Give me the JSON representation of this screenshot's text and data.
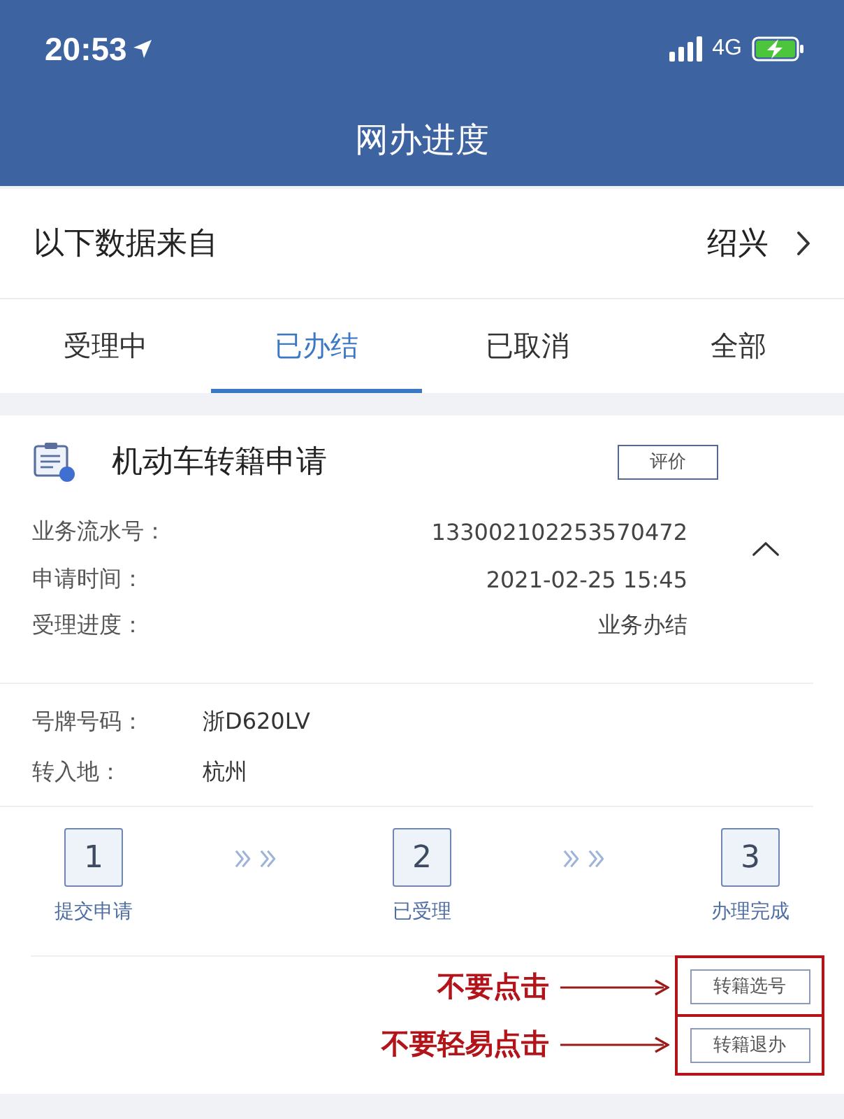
{
  "status_bar": {
    "time": "20:53",
    "network": "4G",
    "charging": true
  },
  "nav_bar": {
    "title": "网办进度"
  },
  "source": {
    "label": "以下数据来自",
    "city": "绍兴"
  },
  "tabs": [
    {
      "label": "受理中",
      "selected": false
    },
    {
      "label": "已办结",
      "selected": true
    },
    {
      "label": "已取消",
      "selected": false
    },
    {
      "label": "全部",
      "selected": false
    }
  ],
  "application": {
    "title": "机动车转籍申请",
    "rate_button": "评价",
    "expanded": true,
    "details": [
      {
        "label": "业务流水号：",
        "value": "133002102253570472"
      },
      {
        "label": "申请时间：",
        "value": "2021-02-25 15:45"
      },
      {
        "label": "受理进度：",
        "value": "业务办结"
      }
    ],
    "vehicle": [
      {
        "label": "号牌号码：",
        "value": "浙D620LV"
      },
      {
        "label": "转入地：",
        "value": "杭州"
      }
    ],
    "steps": [
      {
        "number": "1",
        "label": "提交申请"
      },
      {
        "number": "2",
        "label": "已受理"
      },
      {
        "number": "3",
        "label": "办理完成"
      }
    ],
    "actions": [
      {
        "label": "转籍选号",
        "note": "不要点击"
      },
      {
        "label": "转籍退办",
        "note": "不要轻易点击"
      }
    ]
  }
}
